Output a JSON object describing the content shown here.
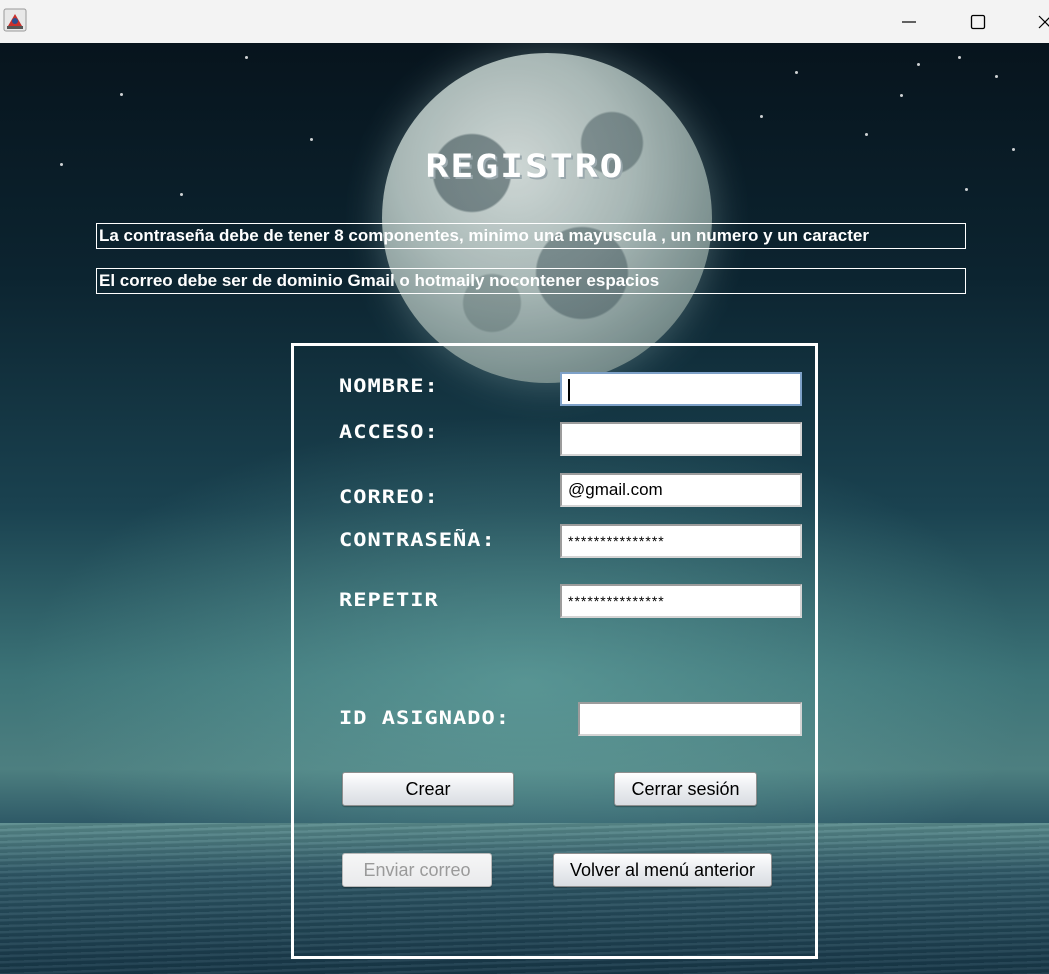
{
  "window": {
    "controls": {
      "minimize_icon": "minimize-icon",
      "maximize_icon": "maximize-icon",
      "close_icon": "close-icon"
    }
  },
  "form": {
    "title": "REGISTRO",
    "rules": [
      "La contraseña debe de tener 8 componentes, minimo una mayuscula , un numero y un caracter",
      "El correo debe ser de dominio Gmail o hotmaily nocontener espacios"
    ],
    "labels": {
      "nombre": "NOMBRE:",
      "acceso": "ACCESO:",
      "correo": "CORREO:",
      "contrasena": "CONTRASEÑA:",
      "repetir": "REPETIR",
      "id_asignado": "ID ASIGNADO:"
    },
    "values": {
      "nombre": "",
      "acceso": "",
      "correo": "@gmail.com",
      "contrasena": "***************",
      "repetir": "***************",
      "id_asignado": ""
    },
    "buttons": {
      "crear": "Crear",
      "cerrar_sesion": "Cerrar sesión",
      "enviar_correo": "Enviar correo",
      "volver": "Volver al menú anterior"
    }
  },
  "colors": {
    "text": "#ffffff",
    "panel_border": "#ffffff",
    "field_focus_border": "#7ea1c8",
    "disabled_text": "#9a9a9a"
  }
}
